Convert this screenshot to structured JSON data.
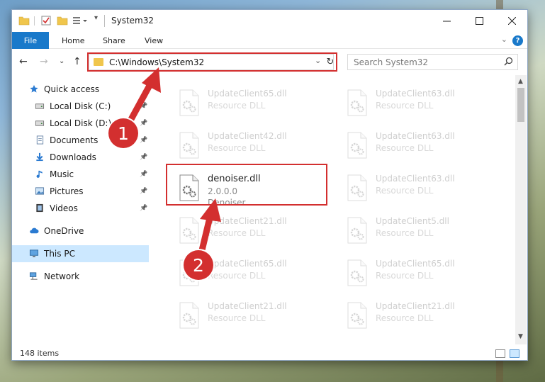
{
  "window": {
    "title": "System32",
    "controls": {
      "minimize": "minimize-icon",
      "maximize": "maximize-icon",
      "close": "close-icon"
    }
  },
  "ribbon": {
    "tabs": [
      "File",
      "Home",
      "Share",
      "View"
    ],
    "help": "?"
  },
  "navigation": {
    "address": "C:\\Windows\\System32",
    "search_placeholder": "Search System32"
  },
  "sidebar": {
    "items": [
      {
        "label": "Quick access",
        "icon": "star-icon",
        "pinned": false
      },
      {
        "label": "Local Disk (C:)",
        "icon": "drive-icon",
        "pinned": true
      },
      {
        "label": "Local Disk (D:)",
        "icon": "drive-icon",
        "pinned": true
      },
      {
        "label": "Documents",
        "icon": "documents-icon",
        "pinned": true
      },
      {
        "label": "Downloads",
        "icon": "download-icon",
        "pinned": true
      },
      {
        "label": "Music",
        "icon": "music-icon",
        "pinned": true
      },
      {
        "label": "Pictures",
        "icon": "pictures-icon",
        "pinned": true
      },
      {
        "label": "Videos",
        "icon": "videos-icon",
        "pinned": true
      },
      {
        "label": "OneDrive",
        "icon": "cloud-icon",
        "pinned": false
      },
      {
        "label": "This PC",
        "icon": "computer-icon",
        "pinned": false,
        "selected": true
      },
      {
        "label": "Network",
        "icon": "network-icon",
        "pinned": false
      }
    ]
  },
  "files": [
    {
      "name": "UpdateClient65.dll",
      "desc": "Resource DLL"
    },
    {
      "name": "UpdateClient63.dll",
      "desc": "Resource DLL"
    },
    {
      "name": "UpdateClient42.dll",
      "desc": "Resource DLL"
    },
    {
      "name": "UpdateClient63.dll",
      "desc": "Resource DLL"
    },
    {
      "name": "denoiser.dll",
      "version": "2.0.0.0",
      "desc": "Denoiser",
      "active": true
    },
    {
      "name": "UpdateClient63.dll",
      "desc": "Resource DLL"
    },
    {
      "name": "UpdateClient21.dll",
      "desc": "Resource DLL"
    },
    {
      "name": "UpdateClient5.dll",
      "desc": "Resource DLL"
    },
    {
      "name": "UpdateClient65.dll",
      "desc": "Resource DLL"
    },
    {
      "name": "UpdateClient65.dll",
      "desc": "Resource DLL"
    },
    {
      "name": "UpdateClient21.dll",
      "desc": "Resource DLL"
    },
    {
      "name": "UpdateClient21.dll",
      "desc": "Resource DLL"
    }
  ],
  "status": {
    "item_count": "148 items"
  },
  "annotations": {
    "step1": "1",
    "step2": "2",
    "color": "#d32f2f"
  }
}
